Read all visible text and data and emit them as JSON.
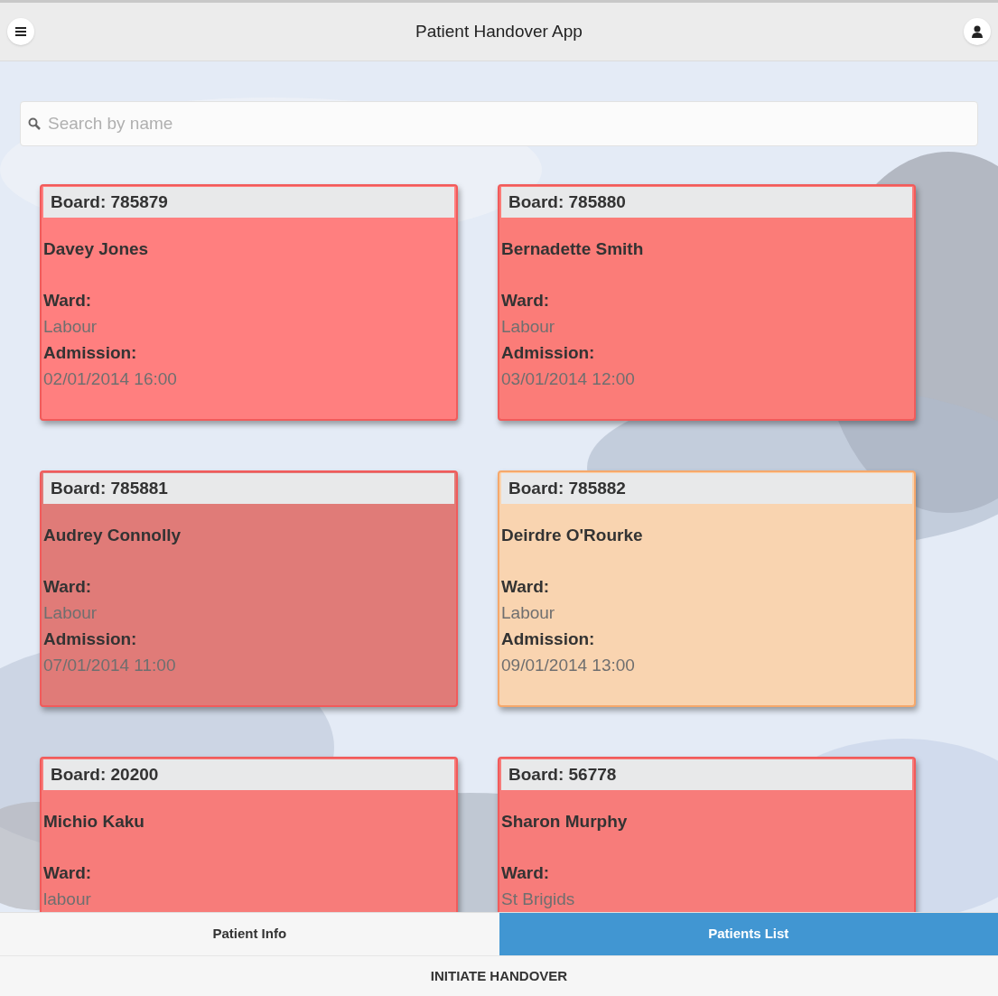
{
  "header": {
    "title": "Patient Handover App"
  },
  "search": {
    "placeholder": "Search by name"
  },
  "cards": [
    {
      "board": "Board: 785879",
      "name": "Davey Jones",
      "ward_label": "Ward:",
      "ward": "Labour",
      "admission_label": "Admission:",
      "admission": "02/01/2014 16:00",
      "color": "#ff7f7f"
    },
    {
      "board": "Board: 785880",
      "name": "Bernadette Smith",
      "ward_label": "Ward:",
      "ward": "Labour",
      "admission_label": "Admission:",
      "admission": "03/01/2014 12:00",
      "color": "#fb7c78"
    },
    {
      "board": "Board: 785881",
      "name": "Audrey Connolly",
      "ward_label": "Ward:",
      "ward": "Labour",
      "admission_label": "Admission:",
      "admission": "07/01/2014 11:00",
      "color": "#e07b78"
    },
    {
      "board": "Board: 785882",
      "name": "Deirdre O'Rourke",
      "ward_label": "Ward:",
      "ward": "Labour",
      "admission_label": "Admission:",
      "admission": "09/01/2014 13:00",
      "color": "#f9d4b0"
    },
    {
      "board": "Board: 20200",
      "name": "Michio Kaku",
      "ward_label": "Ward:",
      "ward": "labour",
      "color": "#f77c7a"
    },
    {
      "board": "Board: 56778",
      "name": "Sharon Murphy",
      "ward_label": "Ward:",
      "ward": "St Brigids",
      "color": "#f77c7a"
    }
  ],
  "tabs": [
    {
      "label": "Patient Info",
      "selected": false
    },
    {
      "label": "Patients List",
      "selected": true
    }
  ],
  "action": {
    "label": "INITIATE HANDOVER"
  }
}
